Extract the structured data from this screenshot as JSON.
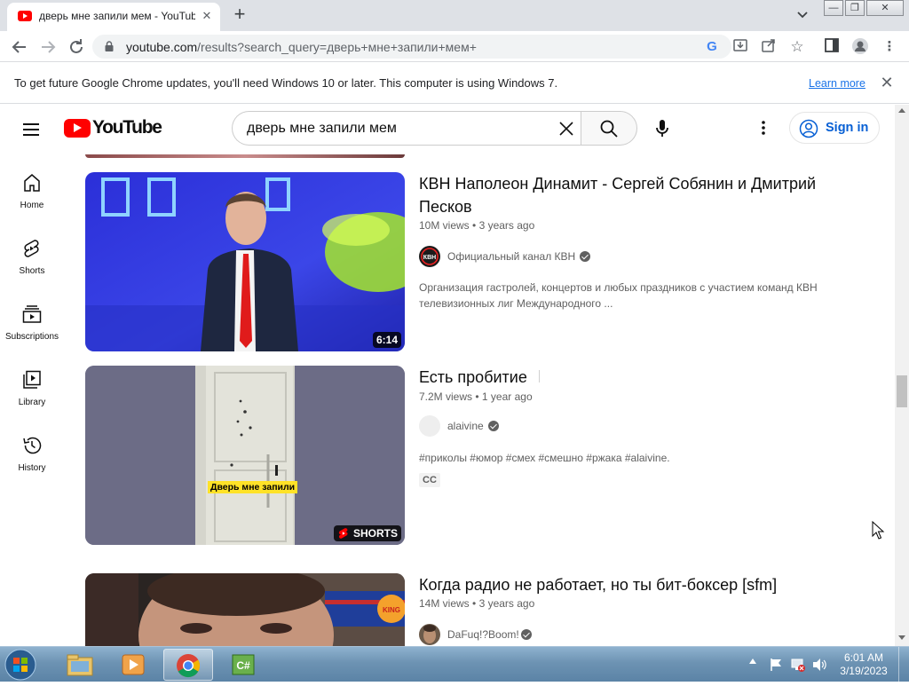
{
  "browser": {
    "tab_title": "дверь мне запили мем - YouTube",
    "url_host": "youtube.com",
    "url_rest": "/results?search_query=дверь+мне+запили+мем+",
    "window_buttons": [
      "—",
      "❐",
      "✕"
    ]
  },
  "infobar": {
    "message": "To get future Google Chrome updates, you'll need Windows 10 or later. This computer is using Windows 7.",
    "learn_more": "Learn more"
  },
  "youtube": {
    "logo_text": "YouTube",
    "search_value": "дверь мне запили мем",
    "sign_in": "Sign in",
    "brand_color": "#ff0000",
    "sidebar": [
      {
        "label": "Home",
        "icon": "home-icon"
      },
      {
        "label": "Shorts",
        "icon": "shorts-icon"
      },
      {
        "label": "Subscriptions",
        "icon": "subscriptions-icon"
      },
      {
        "label": "Library",
        "icon": "library-icon"
      },
      {
        "label": "History",
        "icon": "history-icon"
      }
    ]
  },
  "results": [
    {
      "title_line1": "КВН Наполеон Динамит - Сергей Собянин и Дмитрий",
      "title_line2": "Песков",
      "views": "10M views",
      "age": "3 years ago",
      "channel": "Официальный канал КВН",
      "verified": true,
      "desc_line1": "Организация гастролей, концертов и любых праздников с участием команд КВН",
      "desc_line2": "телевизионных лиг Международного ...",
      "duration": "6:14"
    },
    {
      "title": "Есть пробитие",
      "views": "7.2M views",
      "age": "1 year ago",
      "channel": "alaivine",
      "verified": true,
      "desc": "#приколы #юмор #смех #смешно #ржака #alaivine.",
      "badge": "CC",
      "caption": "Дверь мне запили",
      "overlay": "SHORTS"
    },
    {
      "title": "Когда радио не работает, но ты бит-боксер [sfm]",
      "views": "14M views",
      "age": "3 years ago",
      "channel": "DaFuq!?Boom!",
      "verified": true
    }
  ],
  "taskbar": {
    "time": "6:01 AM",
    "date": "3/19/2023"
  }
}
